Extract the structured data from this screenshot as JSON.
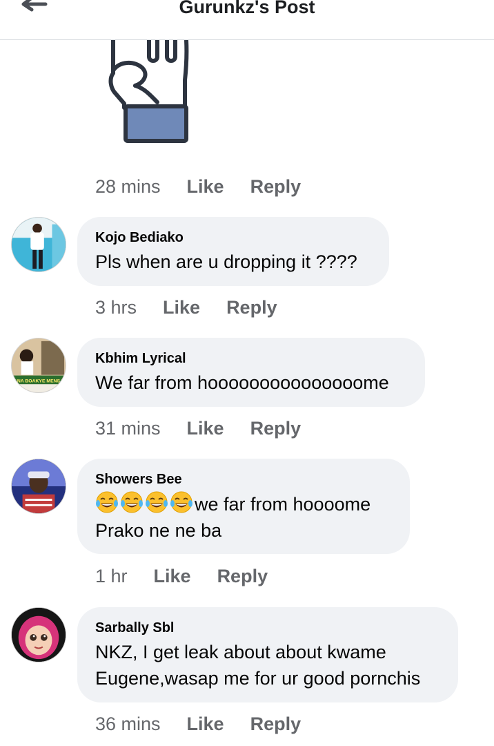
{
  "header": {
    "title": "Gurunkz's Post"
  },
  "comments": [
    {
      "author": "",
      "text": "",
      "time": "28 mins",
      "like_label": "Like",
      "reply_label": "Reply"
    },
    {
      "author": "Kojo Bediako",
      "text": "Pls when are u  dropping it ????",
      "time": "3 hrs",
      "like_label": "Like",
      "reply_label": "Reply"
    },
    {
      "author": "Kbhim Lyrical",
      "text": "We far from hooooooooooooooome",
      "time": "31 mins",
      "like_label": "Like",
      "reply_label": "Reply",
      "avatar_text": "ANA BOAKYE MENSA"
    },
    {
      "author": "Showers Bee",
      "text_line1": "we far from hoooome",
      "text_line2": "Prako ne ne ba",
      "time": "1 hr",
      "like_label": "Like",
      "reply_label": "Reply"
    },
    {
      "author": "Sarbally Sbl",
      "text_line1": "NKZ, I get leak about about kwame",
      "text_line2": "Eugene,wasap me for ur good pornchis",
      "time": "36 mins",
      "like_label": "Like",
      "reply_label": "Reply"
    }
  ],
  "icons": {
    "back": "arrow-left-icon",
    "sticker": "raised-fist-sticker",
    "emoji": "tears-of-joy-emoji"
  },
  "colors": {
    "bubble_bg": "#f0f2f5",
    "meta_text": "#65676b",
    "sticker_cuff": "#6f89b8"
  }
}
